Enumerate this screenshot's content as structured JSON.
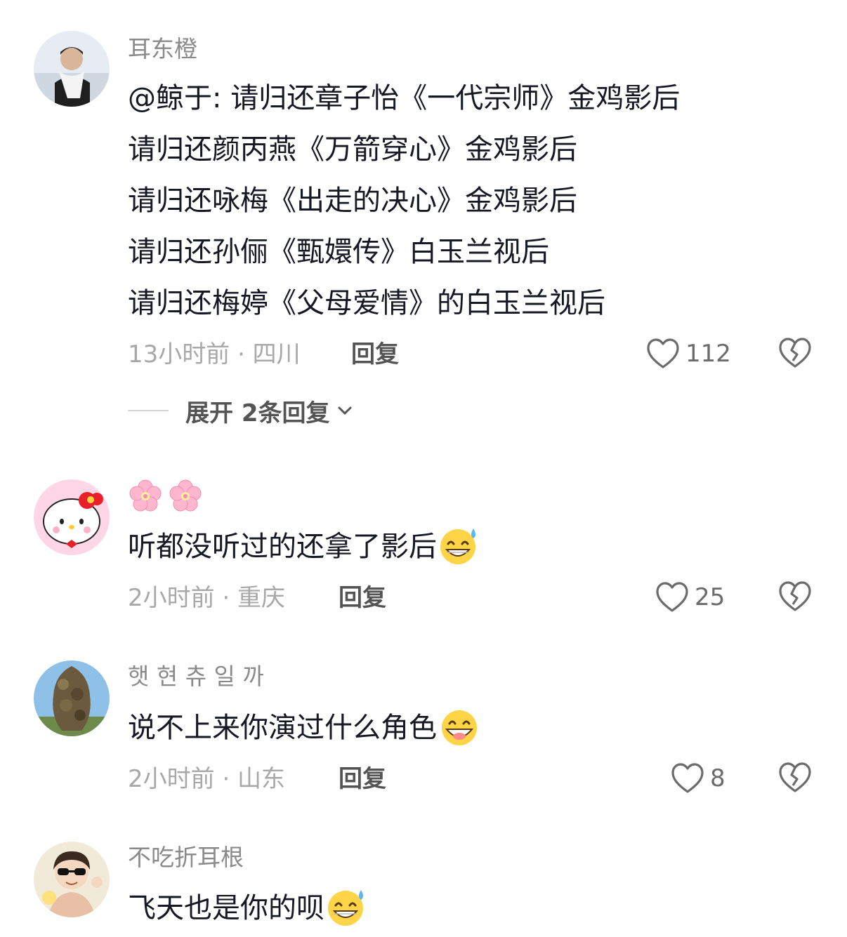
{
  "comments": [
    {
      "username": "耳东橙",
      "lines": [
        "@鲸于: 请归还章子怡《一代宗师》金鸡影后",
        "请归还颜丙燕《万箭穿心》金鸡影后",
        "请归还咏梅《出走的决心》金鸡影后",
        "请归还孙俪《甄嬛传》白玉兰视后",
        "请归还梅婷《父母爱情》的白玉兰视后"
      ],
      "meta": "13小时前 · 四川",
      "reply_label": "回复",
      "likes": "112",
      "expand_label": "展开 2条回复"
    },
    {
      "username": "🌸🌸",
      "lines": [
        "听都没听过的还拿了影后"
      ],
      "meta": "2小时前 · 重庆",
      "reply_label": "回复",
      "likes": "25"
    },
    {
      "username": "햇 현 츄 일 까",
      "lines": [
        "说不上来你演过什么角色"
      ],
      "meta": "2小时前 · 山东",
      "reply_label": "回复",
      "likes": "8"
    },
    {
      "username": "不吃折耳根",
      "lines": [
        "飞天也是你的呗"
      ]
    }
  ],
  "icons": {
    "like": "heart-outline-icon",
    "dislike": "broken-heart-icon",
    "expand": "chevron-down-icon",
    "emoji_sweat": "sweat-grin-emoji",
    "emoji_grin": "grin-emoji",
    "flower": "cherry-blossom-emoji"
  },
  "colors": {
    "text": "#161823",
    "username": "#8a8a8a",
    "meta": "#a8a8a8",
    "action": "#545454"
  }
}
